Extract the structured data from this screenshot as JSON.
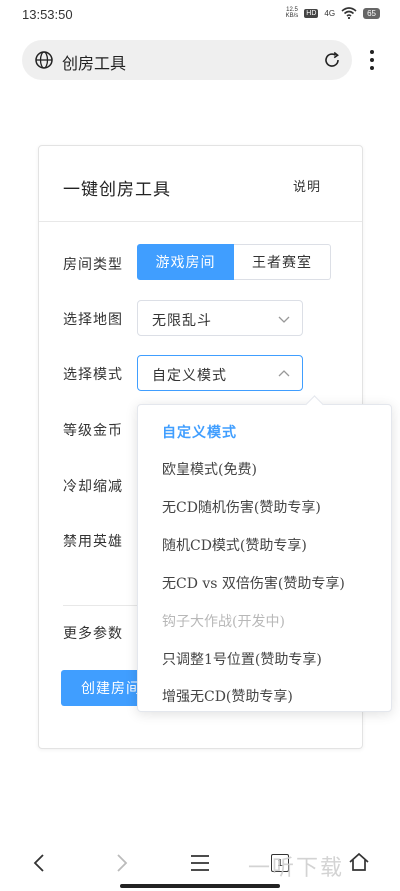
{
  "status_bar": {
    "time": "13:53:50",
    "net_speed_value": "12.5",
    "net_speed_unit": "KB/s",
    "hd_badge": "HD",
    "network": "4G",
    "battery": "65"
  },
  "address_bar": {
    "text": "创房工具"
  },
  "card": {
    "title": "一键创房工具",
    "help_link": "说明",
    "room_type_label": "房间类型",
    "room_type_options": [
      "游戏房间",
      "王者赛室"
    ],
    "room_type_selected": "游戏房间",
    "map_label": "选择地图",
    "map_value": "无限乱斗",
    "mode_label": "选择模式",
    "mode_value": "自定义模式",
    "level_gold_label": "等级金币",
    "cooldown_label": "冷却缩减",
    "ban_hero_label": "禁用英雄",
    "more_params_label": "更多参数",
    "create_button": "创建房间"
  },
  "mode_dropdown": {
    "items": [
      "自定义模式",
      "欧皇模式(免费)",
      "无CD随机伤害(赞助专享)",
      "随机CD模式(赞助专享)",
      "无CD vs 双倍伤害(赞助专享)",
      "钩子大作战(开发中)",
      "只调整1号位置(赞助专享)",
      "增强无CD(赞助专享)"
    ],
    "selected_index": 0,
    "disabled_index": 5
  },
  "colors": {
    "accent": "#409eff",
    "border": "#dcdfe6",
    "disabled_text": "#b8b8b8"
  },
  "watermark": "一听下载"
}
